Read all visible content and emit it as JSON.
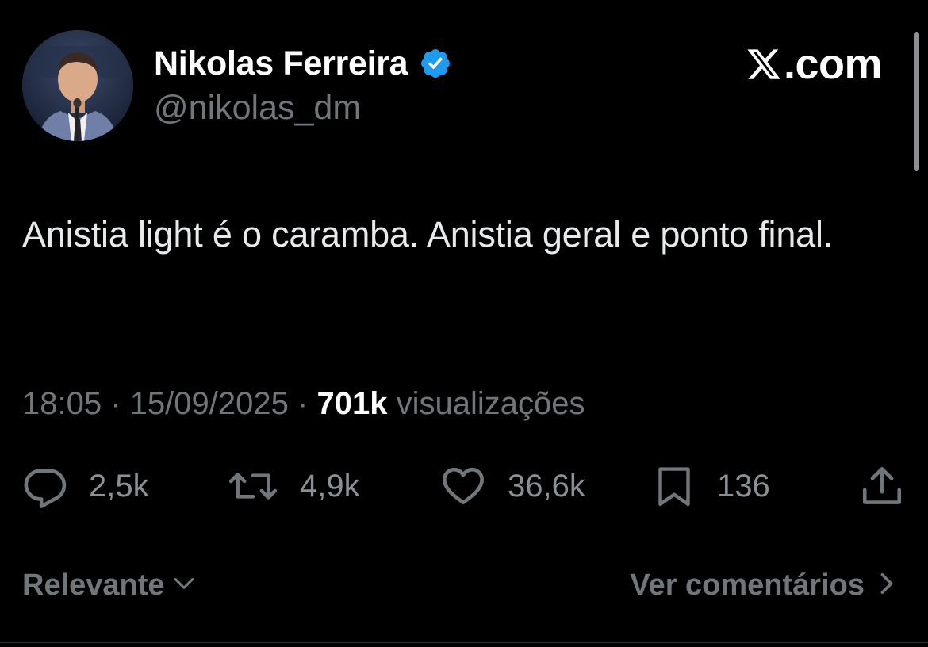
{
  "author": {
    "display_name": "Nikolas Ferreira",
    "handle": "@nikolas_dm",
    "verified": true,
    "verified_color": "#1d9bf0"
  },
  "brand": {
    "logo_icon": "x-logo-icon",
    "text": ".com"
  },
  "tweet": {
    "text": "Anistia light é o caramba. Anistia geral e ponto final.",
    "time": "18:05",
    "date": "15/09/2025",
    "separator": "·",
    "views_count": "701k",
    "views_label": "visualizações"
  },
  "actions": {
    "replies": {
      "icon": "reply-icon",
      "count": "2,5k"
    },
    "reposts": {
      "icon": "repost-icon",
      "count": "4,9k"
    },
    "likes": {
      "icon": "like-icon",
      "count": "36,6k"
    },
    "bookmarks": {
      "icon": "bookmark-icon",
      "count": "136"
    },
    "share": {
      "icon": "share-icon"
    }
  },
  "footer": {
    "sort_label": "Relevante",
    "comments_label": "Ver comentários"
  },
  "colors": {
    "background": "#000000",
    "text": "#e7e9ea",
    "muted": "#71767b",
    "accent": "#1d9bf0"
  }
}
